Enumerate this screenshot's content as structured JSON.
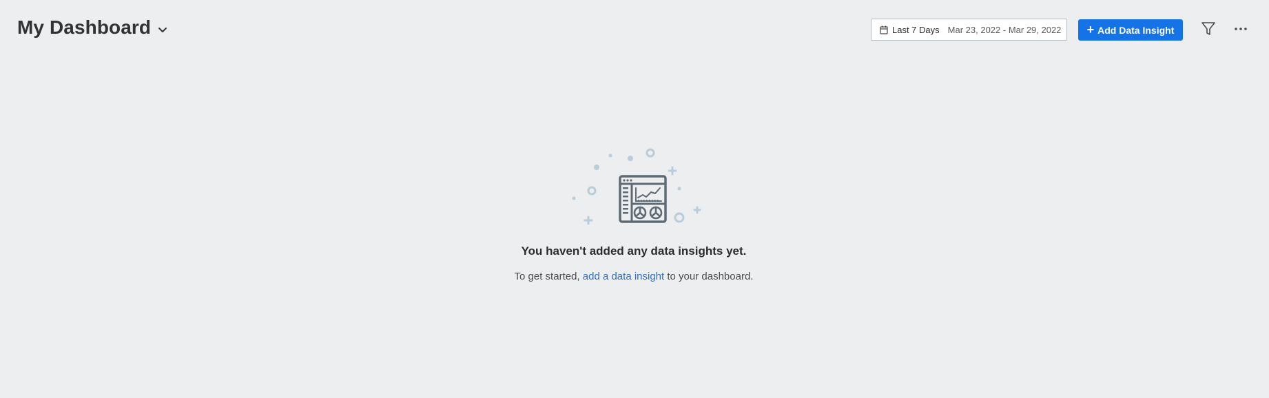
{
  "header": {
    "title": "My Dashboard"
  },
  "date_picker": {
    "preset": "Last 7 Days",
    "range": "Mar 23, 2022 - Mar 29, 2022"
  },
  "toolbar": {
    "add_label": "Add Data Insight"
  },
  "empty_state": {
    "heading": "You haven't added any data insights yet.",
    "sub_before": "To get started,",
    "sub_link": "add a data insight",
    "sub_after": "to your dashboard."
  },
  "colors": {
    "background": "#eceef0",
    "accent": "#1473e6",
    "link": "#2f6fc6",
    "illustration": "#5e6b74",
    "illustration_light": "#b9ccd9"
  },
  "icons": [
    "chevron-down-icon",
    "calendar-icon",
    "plus-icon",
    "filter-icon",
    "more-icon",
    "dashboard-illustration"
  ]
}
